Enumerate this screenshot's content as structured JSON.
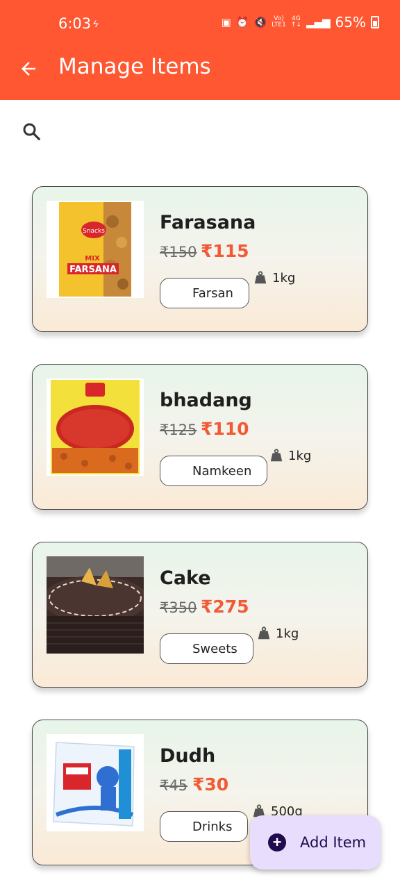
{
  "status_bar": {
    "time": "6:03",
    "battery": "65%"
  },
  "header": {
    "title": "Manage Items",
    "back_icon": "arrow-left-icon",
    "background_color": "#fe5731"
  },
  "search": {
    "icon": "search-icon"
  },
  "items": [
    {
      "name": "Farasana",
      "mrp": "₹150",
      "price": "₹115",
      "category": "Farsan",
      "weight": "1kg",
      "image": "farsana-packet"
    },
    {
      "name": "bhadang",
      "mrp": "₹125",
      "price": "₹110",
      "category": "Namkeen",
      "weight": "1kg",
      "image": "bhadang-packet"
    },
    {
      "name": "Cake",
      "mrp": "₹350",
      "price": "₹275",
      "category": "Sweets",
      "weight": "1kg",
      "image": "chocolate-cake"
    },
    {
      "name": "Dudh",
      "mrp": "₹45",
      "price": "₹30",
      "category": "Drinks",
      "weight": "500g",
      "image": "amul-milk-packet"
    }
  ],
  "fab": {
    "label": "Add Item",
    "icon": "plus-circle-icon",
    "background_color": "#e8ddfc"
  },
  "colors": {
    "price_color": "#f05a36",
    "primary": "#fe5731"
  }
}
